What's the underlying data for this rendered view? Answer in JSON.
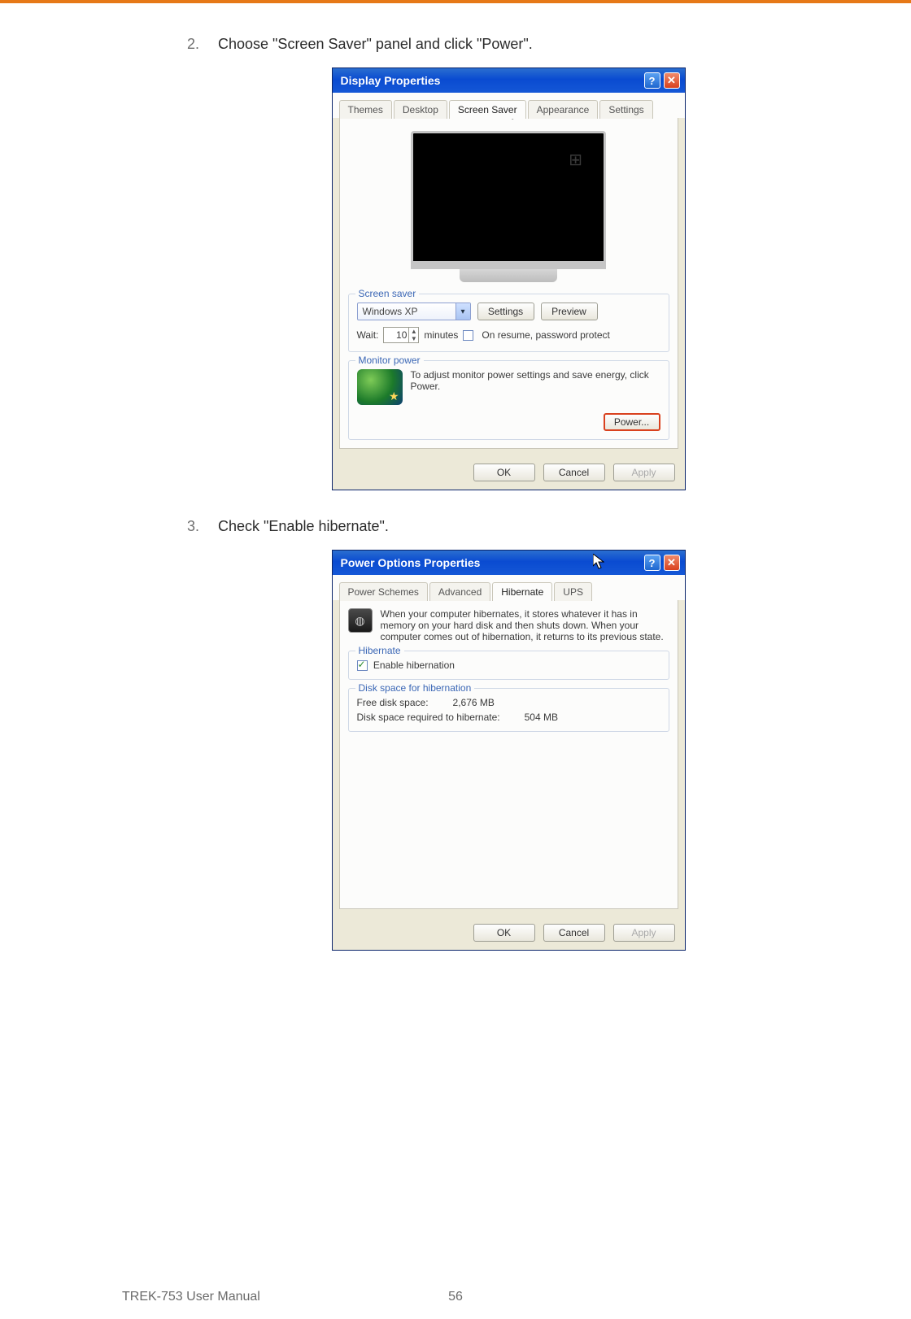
{
  "steps": [
    {
      "num": "2.",
      "text": "Choose \"Screen Saver\" panel and click \"Power\"."
    },
    {
      "num": "3.",
      "text": "Check \"Enable hibernate\"."
    }
  ],
  "dialog1": {
    "title": "Display Properties",
    "tabs": [
      "Themes",
      "Desktop",
      "Screen Saver",
      "Appearance",
      "Settings"
    ],
    "activeTab": "Screen Saver",
    "screenSaver": {
      "legend": "Screen saver",
      "selected": "Windows XP",
      "settingsBtn": "Settings",
      "previewBtn": "Preview",
      "waitLabel": "Wait:",
      "waitValue": "10",
      "waitUnit": "minutes",
      "resumeLabel": "On resume, password protect"
    },
    "monitorPower": {
      "legend": "Monitor power",
      "text": "To adjust monitor power settings and save energy, click Power.",
      "powerBtn": "Power..."
    },
    "buttons": {
      "ok": "OK",
      "cancel": "Cancel",
      "apply": "Apply"
    }
  },
  "dialog2": {
    "title": "Power Options Properties",
    "tabs": [
      "Power Schemes",
      "Advanced",
      "Hibernate",
      "UPS"
    ],
    "activeTab": "Hibernate",
    "intro": "When your computer hibernates, it stores whatever it has in memory on your hard disk and then shuts down. When your computer comes out of hibernation, it returns to its previous state.",
    "hibGroup": {
      "legend": "Hibernate",
      "checkLabel": "Enable hibernation",
      "checked": true
    },
    "diskGroup": {
      "legend": "Disk space for hibernation",
      "freeLabel": "Free disk space:",
      "freeValue": "2,676 MB",
      "reqLabel": "Disk space required to hibernate:",
      "reqValue": "504 MB"
    },
    "buttons": {
      "ok": "OK",
      "cancel": "Cancel",
      "apply": "Apply"
    }
  },
  "footer": {
    "left": "TREK-753 User Manual",
    "page": "56"
  },
  "glyphs": {
    "help": "?",
    "close": "✕",
    "arrow": "▾"
  }
}
